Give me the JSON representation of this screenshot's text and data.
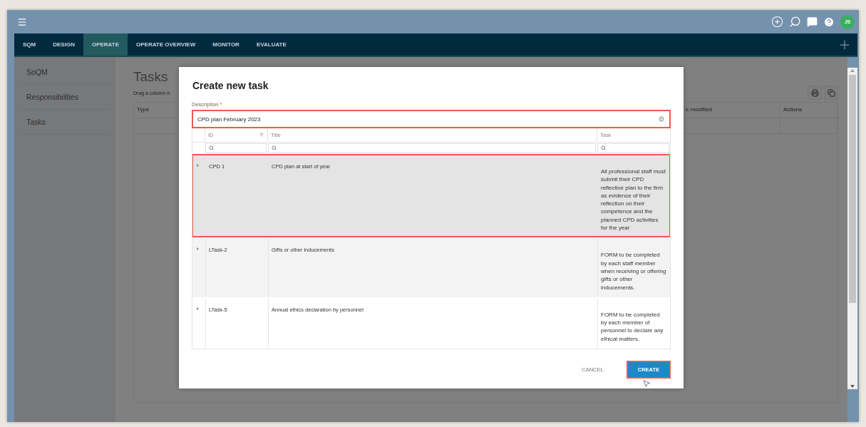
{
  "app_bar": {
    "avatar": "JS"
  },
  "nav": {
    "tabs": [
      {
        "label": "SQM",
        "selected": false
      },
      {
        "label": "DESIGN",
        "selected": false
      },
      {
        "label": "OPERATE",
        "selected": true
      },
      {
        "label": "OPERATE OVERVIEW",
        "selected": false
      },
      {
        "label": "MONITOR",
        "selected": false
      },
      {
        "label": "EVALUATE",
        "selected": false
      }
    ]
  },
  "sidebar": {
    "items": [
      {
        "label": "SoQM"
      },
      {
        "label": "Responsibilities"
      },
      {
        "label": "Tasks"
      }
    ]
  },
  "page": {
    "title": "Tasks",
    "hint": "Drag a column h",
    "columns": [
      "Type",
      "e modified",
      "Actions"
    ]
  },
  "dialog": {
    "title": "Create new task",
    "description": {
      "label": "Description",
      "required_mark": "*",
      "value": "CPD plan February 2023",
      "highlighted": true
    },
    "grid": {
      "columns": [
        {
          "label": "ID",
          "sorted": true
        },
        {
          "label": "Title",
          "sorted": false
        },
        {
          "label": "Task",
          "sorted": false
        }
      ],
      "rows": [
        {
          "id": "CPD 1",
          "title": "CPD plan at start of year",
          "task": "All professional staff must submit their CPD reflective plan to the firm as evidence of their reflection on their competence and the planned CPD activities for the year",
          "selected": true,
          "highlighted": true
        },
        {
          "id": "LTask-2",
          "title": "Gifts or other inducements",
          "task": "FORM to be completed by each staff member when receiving or offering gifts or other inducements.",
          "selected": false,
          "highlighted": false
        },
        {
          "id": "LTask-5",
          "title": "Annual ethics declaration by personnel",
          "task": "FORM to be completed by each member of personnel to declare any ethical matters.",
          "selected": false,
          "highlighted": false
        }
      ]
    },
    "buttons": [
      {
        "label": "CANCEL",
        "kind": "text",
        "highlighted": false
      },
      {
        "label": "CREATE",
        "kind": "primary",
        "highlighted": true
      }
    ]
  }
}
